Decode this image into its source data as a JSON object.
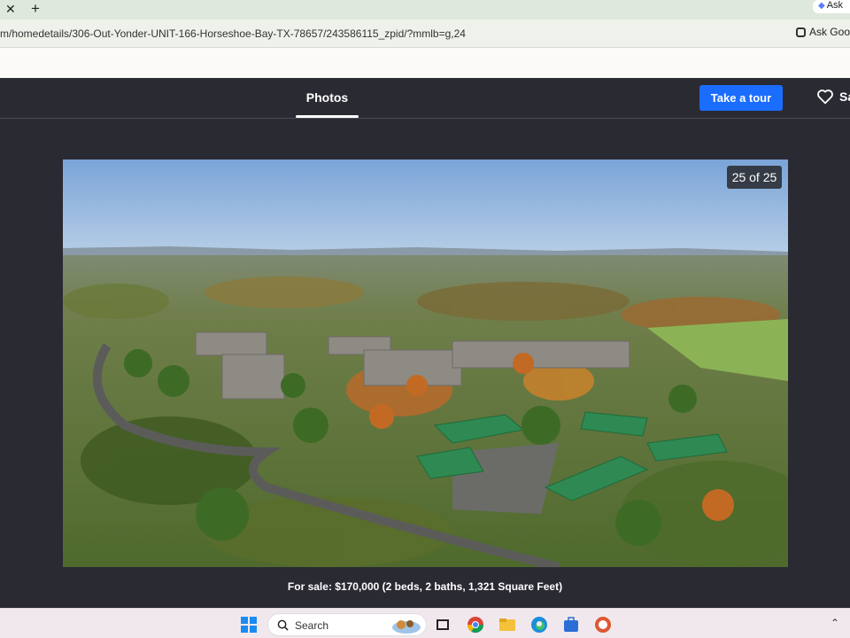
{
  "browser": {
    "tab_close": "✕",
    "tab_new": "+",
    "ask_pill": "Ask",
    "url": "m/homedetails/306-Out-Yonder-UNIT-166-Horseshoe-Bay-TX-78657/243586115_zpid/?mmlb=g,24",
    "ask_google": "Ask Goo"
  },
  "header": {
    "photos_tab": "Photos",
    "tour_button": "Take a tour",
    "save_label": "Sa"
  },
  "photo": {
    "counter": "25 of 25",
    "caption": "For sale: $170,000 (2 beds, 2 baths, 1,321 Square Feet)"
  },
  "taskbar": {
    "search_label": "Search"
  },
  "colors": {
    "accent": "#1a6dff",
    "modal_bg": "#2a2a33"
  }
}
